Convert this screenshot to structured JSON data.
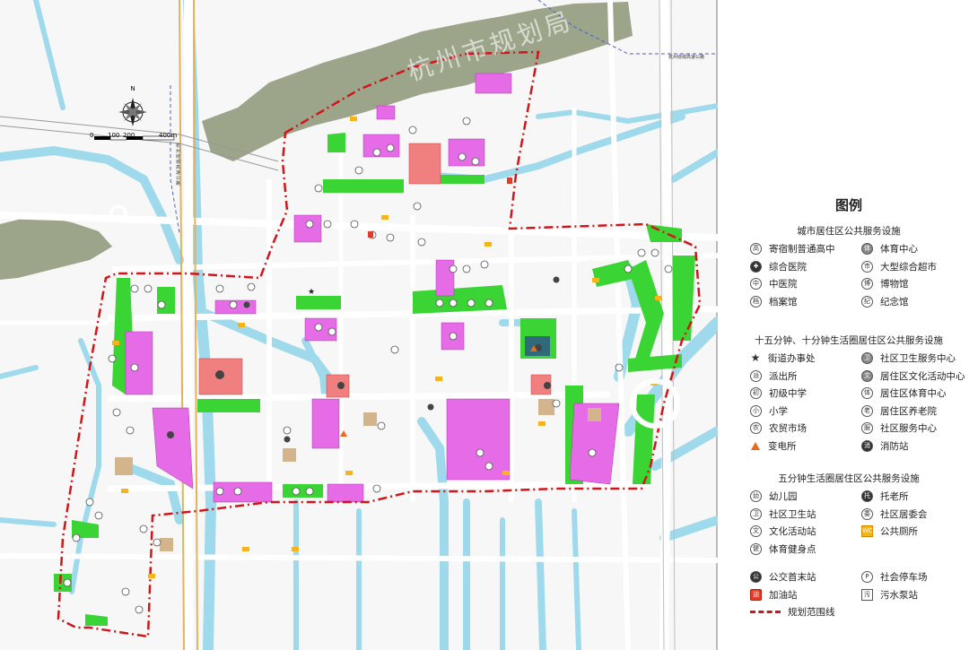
{
  "map": {
    "watermark": "杭州市规划局",
    "north_label": "N",
    "scale": {
      "ticks": [
        "0",
        "100",
        "200",
        "400m"
      ]
    },
    "road_label_west": "杭州绕城高速公路",
    "road_label_ne": "杭州绕城高速公路",
    "colors": {
      "water": "#9fd9ec",
      "green": "#3ad434",
      "public": "#e66be6",
      "medical": "#f08080",
      "hill": "#9ca58a",
      "boundary": "#d0161b",
      "road": "#ffffff"
    }
  },
  "legend": {
    "title": "图例",
    "sections": [
      {
        "title": "城市居住区公共服务设施",
        "items": [
          {
            "icon": "high-school-icon",
            "label": "寄宿制普通高中",
            "glyph": "高",
            "style": ""
          },
          {
            "icon": "sports-center-icon",
            "label": "体育中心",
            "glyph": "体",
            "style": "grey"
          },
          {
            "icon": "general-hospital-icon",
            "label": "综合医院",
            "glyph": "✚",
            "style": "dark"
          },
          {
            "icon": "supermarket-icon",
            "label": "大型综合超市",
            "glyph": "市",
            "style": ""
          },
          {
            "icon": "tcm-hospital-icon",
            "label": "中医院",
            "glyph": "中",
            "style": ""
          },
          {
            "icon": "museum-icon",
            "label": "博物馆",
            "glyph": "博",
            "style": ""
          },
          {
            "icon": "archive-icon",
            "label": "档案馆",
            "glyph": "档",
            "style": ""
          },
          {
            "icon": "memorial-icon",
            "label": "纪念馆",
            "glyph": "纪",
            "style": ""
          }
        ]
      },
      {
        "title": "十五分钟、十分钟生活圈居住区公共服务设施",
        "items": [
          {
            "icon": "sub-district-office-icon",
            "label": "街道办事处",
            "glyph": "★",
            "style": "star"
          },
          {
            "icon": "community-health-center-icon",
            "label": "社区卫生服务中心",
            "glyph": "卫",
            "style": "grey"
          },
          {
            "icon": "police-station-icon",
            "label": "派出所",
            "glyph": "派",
            "style": ""
          },
          {
            "icon": "culture-center-icon",
            "label": "居住区文化活动中心",
            "glyph": "文",
            "style": "grey"
          },
          {
            "icon": "middle-school-icon",
            "label": "初级中学",
            "glyph": "初",
            "style": ""
          },
          {
            "icon": "sports-activity-center-icon",
            "label": "居住区体育中心",
            "glyph": "体",
            "style": ""
          },
          {
            "icon": "primary-school-icon",
            "label": "小学",
            "glyph": "小",
            "style": ""
          },
          {
            "icon": "nursing-home-icon",
            "label": "居住区养老院",
            "glyph": "老",
            "style": ""
          },
          {
            "icon": "farmers-market-icon",
            "label": "农贸市场",
            "glyph": "农",
            "style": ""
          },
          {
            "icon": "community-service-icon",
            "label": "社区服务中心",
            "glyph": "服",
            "style": ""
          },
          {
            "icon": "substation-icon",
            "label": "变电所",
            "glyph": "▲",
            "style": "tri"
          },
          {
            "icon": "fire-station-icon",
            "label": "消防站",
            "glyph": "消",
            "style": "dark"
          }
        ]
      },
      {
        "title": "五分钟生活圈居住区公共服务设施",
        "items": [
          {
            "icon": "kindergarten-icon",
            "label": "幼儿园",
            "glyph": "幼",
            "style": ""
          },
          {
            "icon": "nursery-icon",
            "label": "托老所",
            "glyph": "托",
            "style": "dark"
          },
          {
            "icon": "health-station-icon",
            "label": "社区卫生站",
            "glyph": "卫",
            "style": ""
          },
          {
            "icon": "committee-icon",
            "label": "社区居委会",
            "glyph": "委",
            "style": ""
          },
          {
            "icon": "culture-station-icon",
            "label": "文化活动站",
            "glyph": "文",
            "style": ""
          },
          {
            "icon": "public-toilet-icon",
            "label": "公共厕所",
            "glyph": "WC",
            "style": "yel"
          },
          {
            "icon": "fitness-point-icon",
            "label": "体育健身点",
            "glyph": "健",
            "style": ""
          }
        ]
      },
      {
        "title": "",
        "items": [
          {
            "icon": "bus-terminal-icon",
            "label": "公交首末站",
            "glyph": "公",
            "style": "dark"
          },
          {
            "icon": "parking-icon",
            "label": "社会停车场",
            "glyph": "P",
            "style": ""
          },
          {
            "icon": "gas-station-icon",
            "label": "加油站",
            "glyph": "油",
            "style": "red"
          },
          {
            "icon": "sewage-pump-icon",
            "label": "污水泵站",
            "glyph": "污",
            "style": "sq"
          },
          {
            "icon": "boundary-line-icon",
            "label": "规划范围线",
            "glyph": "",
            "style": "line"
          }
        ]
      }
    ]
  }
}
